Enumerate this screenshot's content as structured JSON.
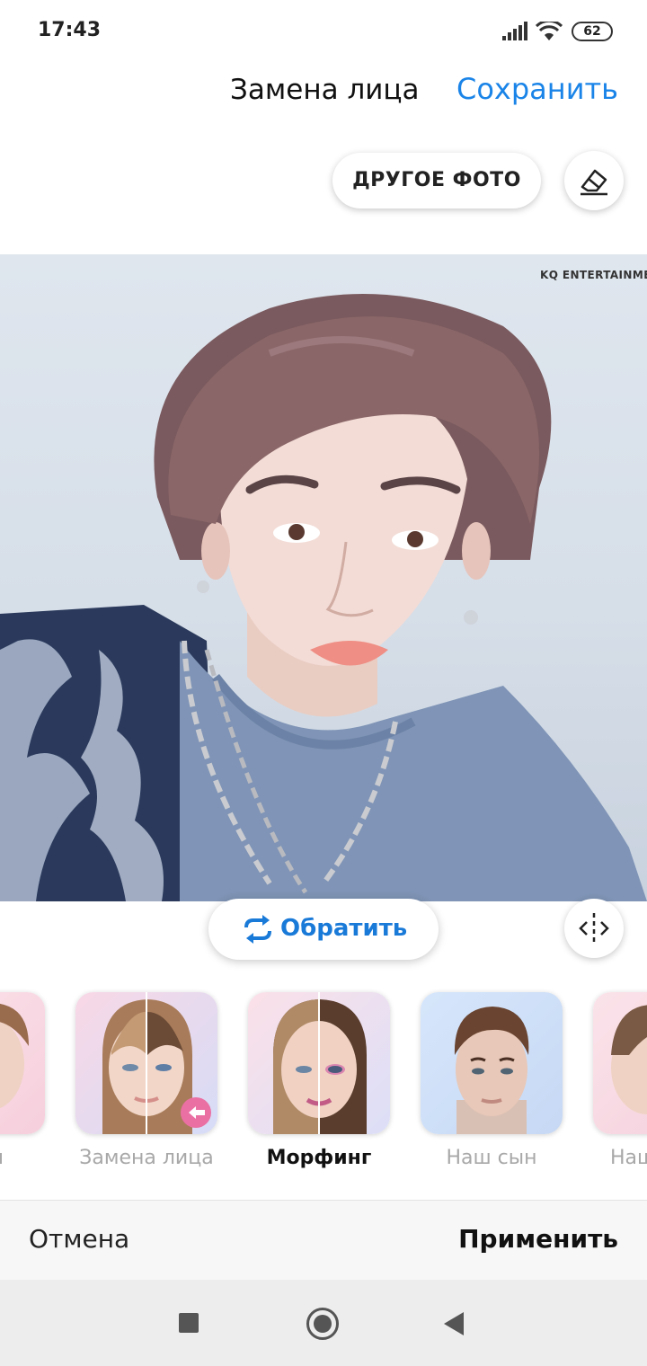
{
  "status": {
    "time": "17:43",
    "battery": "62"
  },
  "header": {
    "title": "Замена лица",
    "save_label": "Сохранить"
  },
  "actions": {
    "other_photo_label": "ДРУГОЕ ФОТО"
  },
  "photo": {
    "watermark": "KQ ENTERTAINME"
  },
  "editor": {
    "reverse_label": "Обратить"
  },
  "carousel": {
    "items": [
      {
        "label": "ал"
      },
      {
        "label": "Замена лица"
      },
      {
        "label": "Морфинг",
        "selected": true
      },
      {
        "label": "Наш сын"
      },
      {
        "label": "Наш"
      }
    ]
  },
  "bottom": {
    "cancel_label": "Отмена",
    "apply_label": "Применить"
  },
  "colors": {
    "accent": "#1a84e8",
    "reverse_blue": "#1a7ad8"
  }
}
